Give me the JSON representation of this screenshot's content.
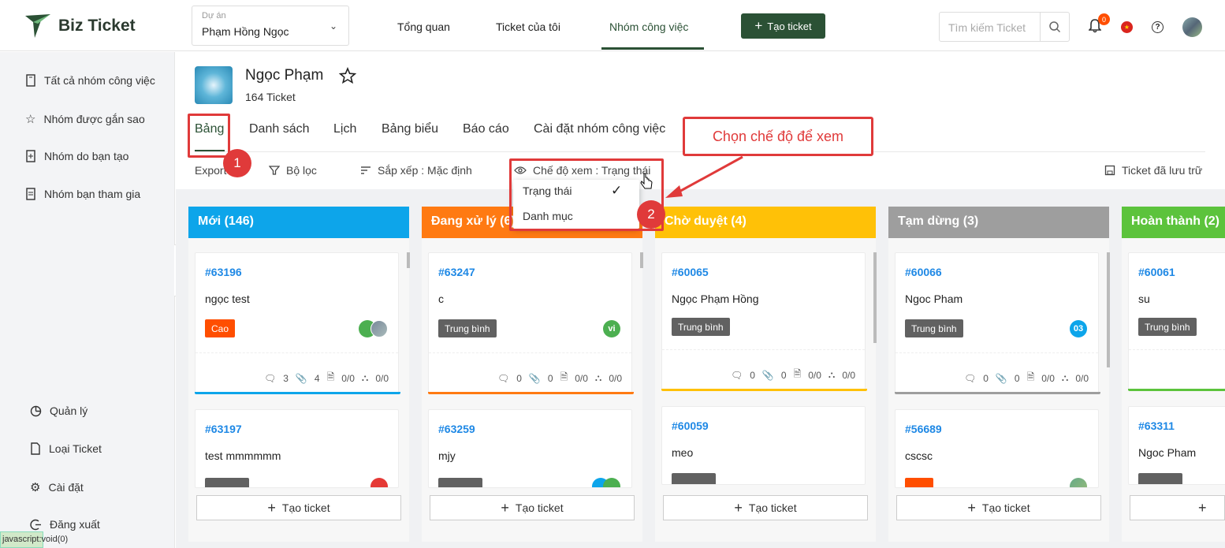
{
  "app": {
    "name": "Biz Ticket"
  },
  "header": {
    "project_label": "Dự án",
    "project_value": "Phạm Hồng Ngọc",
    "nav": [
      "Tổng quan",
      "Ticket của tôi",
      "Nhóm công việc"
    ],
    "create_label": "Tạo ticket",
    "search_placeholder": "Tìm kiếm Ticket",
    "notification_count": "0"
  },
  "sidebar": {
    "items": [
      "Tất cả nhóm công việc",
      "Nhóm được gắn sao",
      "Nhóm do bạn tạo",
      "Nhóm bạn tham gia"
    ],
    "bottom": [
      "Quản lý",
      "Loại Ticket",
      "Cài đặt",
      "Đăng xuất"
    ],
    "status_text": "javascript:void(0)"
  },
  "group": {
    "title": "Ngọc Phạm",
    "count": "164 Ticket"
  },
  "tabs": [
    "Bảng",
    "Danh sách",
    "Lịch",
    "Bảng biểu",
    "Báo cáo",
    "Cài đặt nhóm công việc"
  ],
  "toolbar": {
    "export": "Export",
    "filter": "Bộ lọc",
    "sort": "Sắp xếp : Mặc định",
    "view_mode": "Chế độ xem : Trạng thái",
    "archived": "Ticket đã lưu trữ"
  },
  "view_dropdown": {
    "options": [
      "Trạng thái",
      "Danh mục"
    ],
    "selected": "Trạng thái"
  },
  "annotation": {
    "callout": "Chọn chế độ để xem",
    "step1": "1",
    "step2": "2"
  },
  "columns": [
    {
      "title": "Mới (146)",
      "color": "#0da5ea",
      "cards": [
        {
          "id": "#63196",
          "title": "ngọc test",
          "priority": "Cao",
          "priority_color": "#ff4e00",
          "comments": "3",
          "attachments": "4",
          "docs": "0/0",
          "subtasks": "0/0"
        },
        {
          "id": "#63197",
          "title": "test mmmmmm"
        }
      ]
    },
    {
      "title": "Đang xử lý (6)",
      "color": "#ff7a12",
      "cards": [
        {
          "id": "#63247",
          "title": "c",
          "priority": "Trung bình",
          "priority_color": "#616161",
          "avatar": "vi",
          "comments": "0",
          "attachments": "0",
          "docs": "0/0",
          "subtasks": "0/0"
        },
        {
          "id": "#63259",
          "title": "mjy"
        }
      ]
    },
    {
      "title": "Chờ duyệt (4)",
      "color": "#ffc107",
      "cards": [
        {
          "id": "#60065",
          "title": "Ngọc Phạm Hồng",
          "priority": "Trung bình",
          "priority_color": "#616161",
          "comments": "0",
          "attachments": "0",
          "docs": "0/0",
          "subtasks": "0/0"
        },
        {
          "id": "#60059",
          "title": "meo"
        }
      ]
    },
    {
      "title": "Tạm dừng (3)",
      "color": "#9e9e9e",
      "cards": [
        {
          "id": "#60066",
          "title": "Ngoc Pham",
          "priority": "Trung bình",
          "priority_color": "#616161",
          "avatar": "03",
          "comments": "0",
          "attachments": "0",
          "docs": "0/0",
          "subtasks": "0/0"
        },
        {
          "id": "#56689",
          "title": "cscsc"
        }
      ]
    },
    {
      "title": "Hoàn thành (2)",
      "color": "#5cc33c",
      "cards": [
        {
          "id": "#60061",
          "title": "su",
          "priority": "Trung bình",
          "priority_color": "#616161"
        },
        {
          "id": "#63311",
          "title": "Ngoc Pham"
        }
      ]
    }
  ],
  "add_ticket_label": "Tạo ticket"
}
